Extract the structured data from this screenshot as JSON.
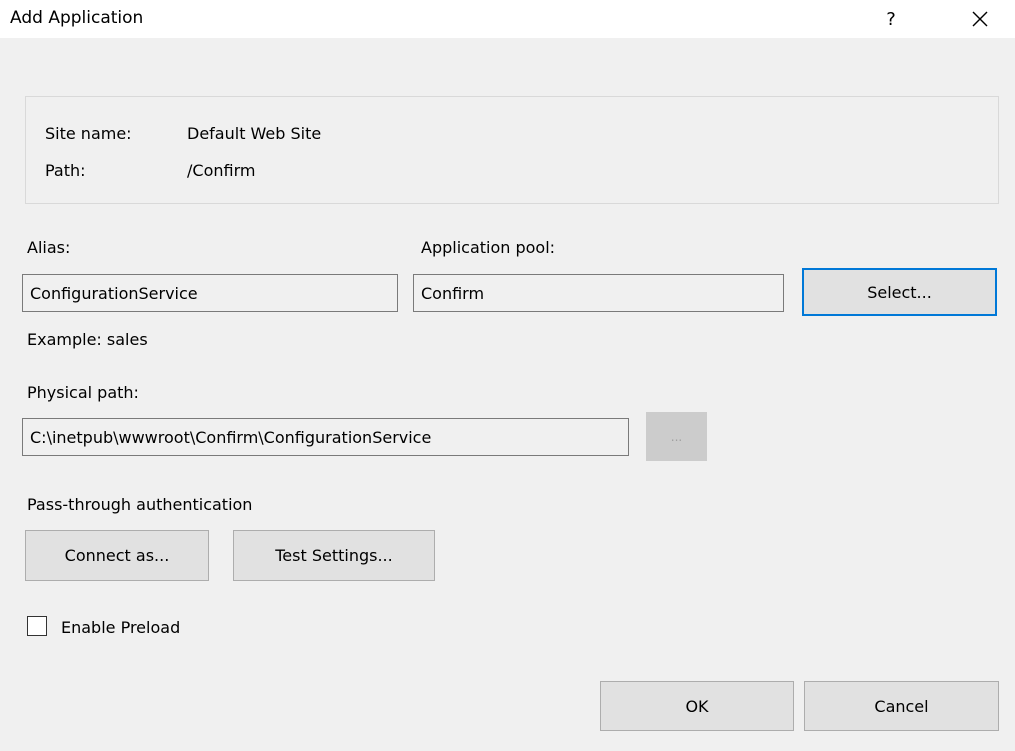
{
  "window": {
    "title": "Add Application",
    "help_glyph": "?",
    "close_icon": "close-icon"
  },
  "info": {
    "site_name_label": "Site name:",
    "site_name_value": "Default Web Site",
    "path_label": "Path:",
    "path_value": "/Confirm"
  },
  "alias": {
    "label": "Alias:",
    "value": "ConfigurationService",
    "example": "Example: sales"
  },
  "app_pool": {
    "label": "Application pool:",
    "value": "Confirm",
    "select_label": "Select..."
  },
  "physical_path": {
    "label": "Physical path:",
    "value": "C:\\inetpub\\wwwroot\\Confirm\\ConfigurationService",
    "browse_label": "..."
  },
  "auth": {
    "label": "Pass-through authentication",
    "connect_label": "Connect as...",
    "test_label": "Test Settings..."
  },
  "preload": {
    "label": "Enable Preload",
    "checked": false
  },
  "footer": {
    "ok_label": "OK",
    "cancel_label": "Cancel"
  },
  "colors": {
    "accent": "#0078d7",
    "background": "#f0f0f0",
    "button_face": "#e1e1e1"
  }
}
